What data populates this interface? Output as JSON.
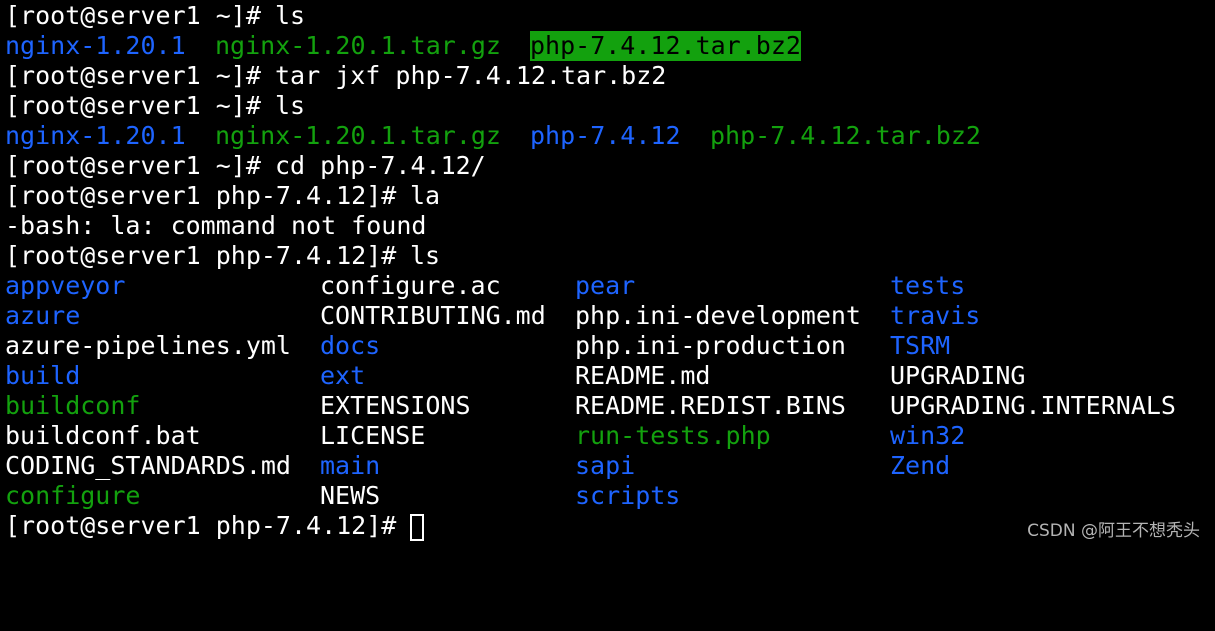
{
  "terminal": {
    "lines": [
      {
        "prompt": "[root@server1 ~]# ",
        "command": "ls"
      },
      {
        "files": [
          "nginx-1.20.1",
          "nginx-1.20.1.tar.gz",
          "php-7.4.12.tar.bz2"
        ]
      },
      {
        "prompt": "[root@server1 ~]# ",
        "command": "tar jxf php-7.4.12.tar.bz2"
      },
      {
        "prompt": "[root@server1 ~]# ",
        "command": "ls"
      },
      {
        "files": [
          "nginx-1.20.1",
          "nginx-1.20.1.tar.gz",
          "php-7.4.12",
          "php-7.4.12.tar.bz2"
        ]
      },
      {
        "prompt": "[root@server1 ~]# ",
        "command": "cd php-7.4.12/"
      },
      {
        "prompt": "[root@server1 php-7.4.12]# ",
        "command": "la"
      },
      {
        "output": "-bash: la: command not found"
      },
      {
        "prompt": "[root@server1 php-7.4.12]# ",
        "command": "ls"
      }
    ],
    "listing": {
      "columns": [
        [
          "appveyor",
          "azure",
          "azure-pipelines.yml",
          "build",
          "buildconf",
          "buildconf.bat",
          "CODING_STANDARDS.md",
          "configure"
        ],
        [
          "configure.ac",
          "CONTRIBUTING.md",
          "docs",
          "ext",
          "EXTENSIONS",
          "LICENSE",
          "main",
          "NEWS"
        ],
        [
          "pear",
          "php.ini-development",
          "php.ini-production",
          "README.md",
          "README.REDIST.BINS",
          "run-tests.php",
          "sapi",
          "scripts"
        ],
        [
          "tests",
          "travis",
          "TSRM",
          "UPGRADING",
          "UPGRADING.INTERNALS",
          "win32",
          "Zend"
        ]
      ]
    },
    "final_prompt": "[root@server1 php-7.4.12]# "
  },
  "colors": {
    "background": "#000000",
    "text": "#ffffff",
    "directory": "#1e64ff",
    "archive_or_exec": "#13a10e",
    "highlight": "#13a10e"
  },
  "watermark": "CSDN @阿王不想秃头"
}
